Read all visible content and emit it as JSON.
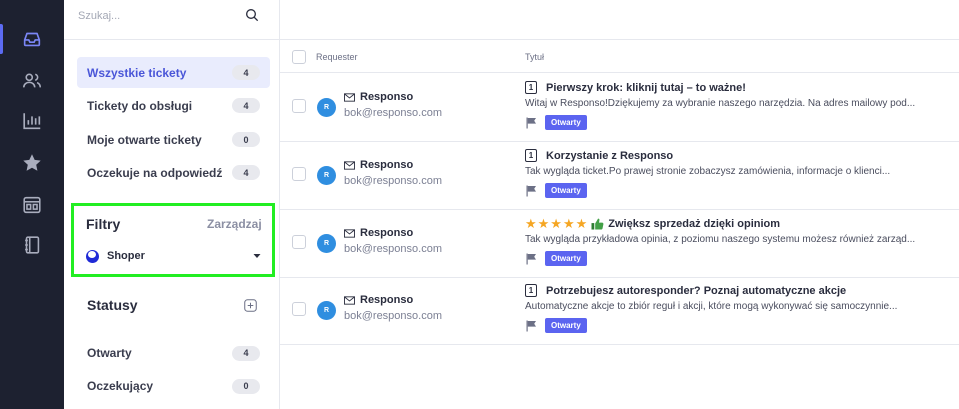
{
  "colors": {
    "rail_bg": "#1d2130",
    "accent": "#5c6bf2",
    "status_open": "#5b64f0",
    "highlight_box": "#22ee22"
  },
  "rail": {
    "items": [
      {
        "icon": "inbox-icon",
        "active": true
      },
      {
        "icon": "users-icon",
        "active": false
      },
      {
        "icon": "bar-chart-icon",
        "active": false
      },
      {
        "icon": "star-icon",
        "active": false
      },
      {
        "icon": "layout-icon",
        "active": false
      },
      {
        "icon": "book-icon",
        "active": false
      }
    ]
  },
  "search": {
    "placeholder": "Szukaj..."
  },
  "folders": [
    {
      "label": "Wszystkie tickety",
      "count": "4"
    },
    {
      "label": "Tickety do obsługi",
      "count": "4"
    },
    {
      "label": "Moje otwarte tickety",
      "count": "0"
    },
    {
      "label": "Oczekuje na odpowiedź",
      "count": "4"
    }
  ],
  "filters": {
    "title": "Filtry",
    "manage_label": "Zarządzaj",
    "selected": "Shoper"
  },
  "statuses": {
    "title": "Statusy",
    "items": [
      {
        "label": "Otwarty",
        "count": "4"
      },
      {
        "label": "Oczekujący",
        "count": "0"
      }
    ]
  },
  "table": {
    "col_requester": "Requester",
    "col_title": "Tytuł",
    "rows": [
      {
        "avatar": "R",
        "requester": "Responso",
        "email": "bok@responso.com",
        "num": "1",
        "title": "Pierwszy krok: kliknij tutaj – to ważne!",
        "preview": "Witaj w Responso!Dziękujemy za wybranie naszego narzędzia. Na adres mailowy pod...",
        "status": "Otwarty"
      },
      {
        "avatar": "R",
        "requester": "Responso",
        "email": "bok@responso.com",
        "num": "1",
        "title": "Korzystanie z Responso",
        "preview": "Tak wygląda ticket.Po prawej stronie zobaczysz zamówienia, informacje o klienci...",
        "status": "Otwarty"
      },
      {
        "avatar": "R",
        "requester": "Responso",
        "email": "bok@responso.com",
        "stars": "★★★★★",
        "title": "Zwiększ sprzedaż dzięki opiniom",
        "preview": "Tak wygląda przykładowa opinia, z poziomu naszego systemu możesz również zarząd...",
        "status": "Otwarty"
      },
      {
        "avatar": "R",
        "requester": "Responso",
        "email": "bok@responso.com",
        "num": "1",
        "title": "Potrzebujesz autoresponder? Poznaj automatyczne akcje",
        "preview": "Automatyczne akcje to zbiór reguł i akcji, które mogą wykonywać się samoczynnie...",
        "status": "Otwarty"
      }
    ]
  }
}
